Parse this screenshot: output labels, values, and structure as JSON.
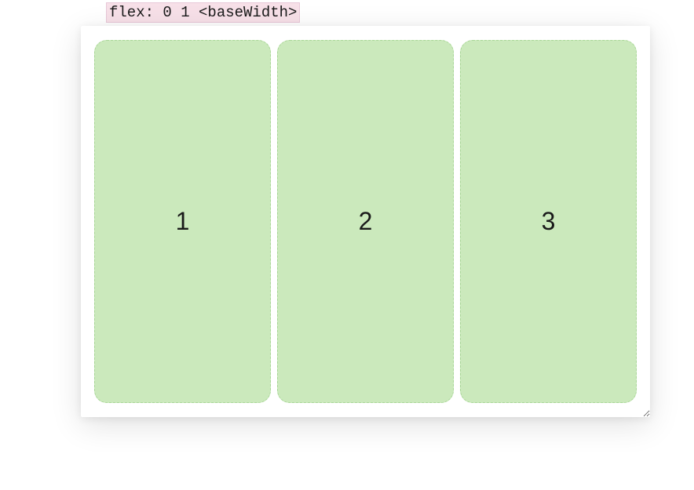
{
  "header": {
    "code_label": "flex: 0 1 <baseWidth>"
  },
  "items": [
    {
      "label": "1"
    },
    {
      "label": "2"
    },
    {
      "label": "3"
    }
  ]
}
